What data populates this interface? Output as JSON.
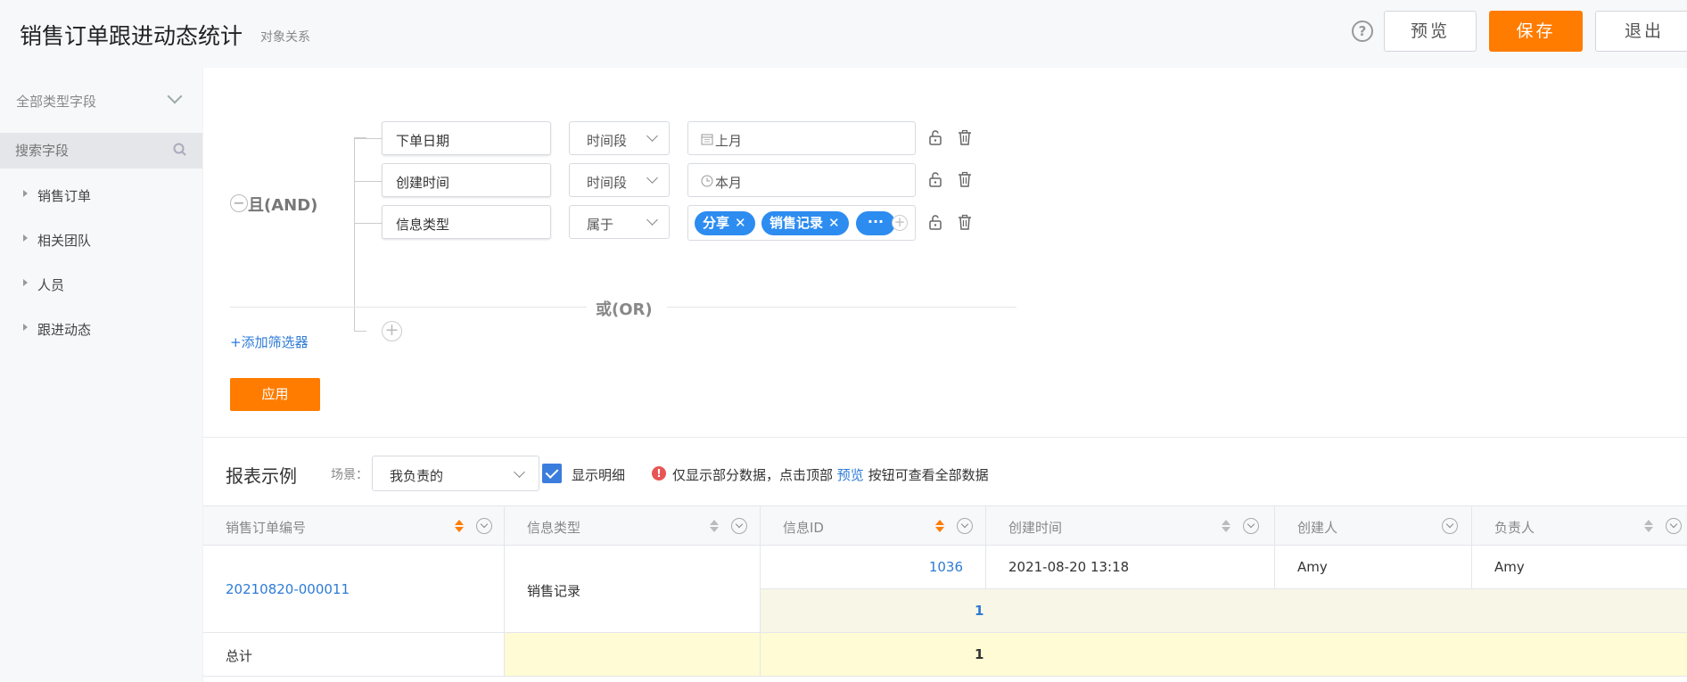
{
  "header": {
    "title": "销售订单跟进动态统计",
    "subtitle": "对象关系",
    "help": "?",
    "preview": "预览",
    "save": "保存",
    "exit": "退出"
  },
  "sidebar": {
    "field_type": "全部类型字段",
    "search_placeholder": "搜索字段",
    "items": [
      {
        "label": "销售订单"
      },
      {
        "label": "相关团队"
      },
      {
        "label": "人员"
      },
      {
        "label": "跟进动态"
      }
    ]
  },
  "filter": {
    "and_label": "且(AND)",
    "conditions": [
      {
        "field": "下单日期",
        "operator": "时间段",
        "value": "上月",
        "value_icon": "calendar-icon"
      },
      {
        "field": "创建时间",
        "operator": "时间段",
        "value": "本月",
        "value_icon": "clock-icon"
      },
      {
        "field": "信息类型",
        "operator": "属于",
        "tags": [
          "分享",
          "销售记录"
        ],
        "more": "···"
      }
    ],
    "or_label": "或(OR)",
    "add_filter": "+添加筛选器",
    "apply": "应用"
  },
  "report": {
    "title": "报表示例",
    "scene_label": "场景：",
    "scene_value": "我负责的",
    "show_detail": "显示明细",
    "show_detail_checked": true,
    "notice_prefix": "仅显示部分数据，点击顶部 ",
    "notice_link": "预览",
    "notice_suffix": " 按钮可查看全部数据",
    "columns": [
      "销售订单编号",
      "信息类型",
      "信息ID",
      "创建时间",
      "创建人",
      "负责人"
    ],
    "rows": [
      {
        "order_no": "20210820-000011",
        "info_type": "销售记录",
        "info_id": "1036",
        "created": "2021-08-20 13:18",
        "creator": "Amy",
        "owner": "Amy"
      }
    ],
    "subtotal": "1",
    "total_label": "总计",
    "total": "1"
  },
  "colors": {
    "accent": "#ff7c00",
    "link": "#2d7bd6",
    "tag": "#2d8cf0",
    "subtotal_bg": "#f8f6e6",
    "total_bg": "#fffbd4"
  }
}
